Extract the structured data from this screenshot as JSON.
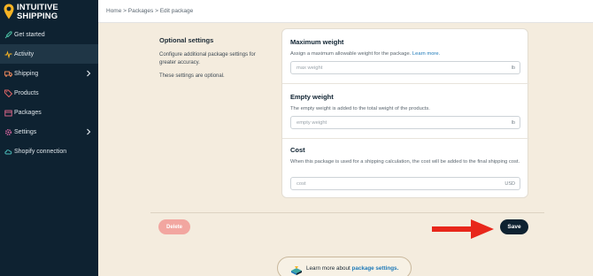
{
  "app": {
    "brand_line1": "INTUITIVE",
    "brand_line2": "SHIPPING",
    "brand_color": "#f5b324"
  },
  "breadcrumb": "Home > Packages > Edit package",
  "sidebar": {
    "items": [
      {
        "label": "Get started",
        "icon": "rocket-icon",
        "active": false
      },
      {
        "label": "Activity",
        "icon": "activity-icon",
        "active": true
      },
      {
        "label": "Shipping",
        "icon": "truck-icon",
        "active": false,
        "expandable": true
      },
      {
        "label": "Products",
        "icon": "tag-icon",
        "active": false
      },
      {
        "label": "Packages",
        "icon": "box-icon",
        "active": false
      },
      {
        "label": "Settings",
        "icon": "gear-icon",
        "active": false,
        "expandable": true
      },
      {
        "label": "Shopify connection",
        "icon": "cloud-icon",
        "active": false
      }
    ]
  },
  "optional": {
    "title": "Optional settings",
    "description": "Configure additional package settings for greater accuracy.",
    "note": "These settings are optional."
  },
  "fields": {
    "max_weight": {
      "title": "Maximum weight",
      "help": "Assign a maximum allowable weight for the package.",
      "help_link": "Learn more.",
      "placeholder": "max weight",
      "value": "",
      "unit": "lb"
    },
    "empty_weight": {
      "title": "Empty weight",
      "help": "The empty weight is added to the total weight of the products.",
      "placeholder": "empty weight",
      "value": "",
      "unit": "lb"
    },
    "cost": {
      "title": "Cost",
      "help": "When this package is used for a shipping calculation, the cost will be added to the final shipping cost.",
      "placeholder": "cost",
      "value": "",
      "unit": "USD"
    }
  },
  "actions": {
    "delete_label": "Delete",
    "save_label": "Save",
    "arrow_color": "#e8271b"
  },
  "learn_more": {
    "text": "Learn more about",
    "link": "package settings."
  },
  "colors": {
    "sidebar_bg": "#0e2231",
    "page_bg": "#f4ecde",
    "delete_bg": "#f2a6a0",
    "save_bg": "#0e2231"
  }
}
